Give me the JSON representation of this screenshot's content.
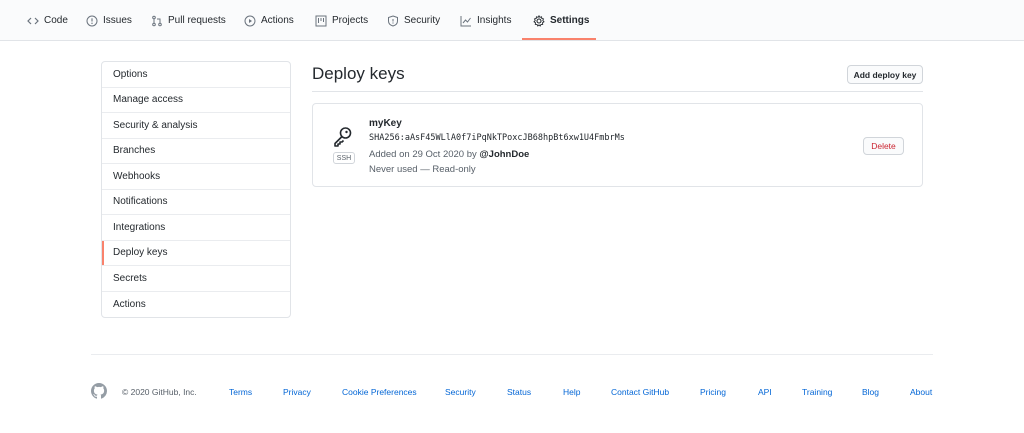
{
  "repo_nav": {
    "tabs": [
      {
        "label": "Code",
        "icon": "code-icon"
      },
      {
        "label": "Issues",
        "icon": "issue-opened-icon"
      },
      {
        "label": "Pull requests",
        "icon": "git-pull-request-icon"
      },
      {
        "label": "Actions",
        "icon": "play-icon"
      },
      {
        "label": "Projects",
        "icon": "project-icon"
      },
      {
        "label": "Security",
        "icon": "shield-icon"
      },
      {
        "label": "Insights",
        "icon": "graph-icon"
      },
      {
        "label": "Settings",
        "icon": "gear-icon",
        "selected": true
      }
    ]
  },
  "sidebar": {
    "items": [
      {
        "label": "Options"
      },
      {
        "label": "Manage access"
      },
      {
        "label": "Security & analysis"
      },
      {
        "label": "Branches"
      },
      {
        "label": "Webhooks"
      },
      {
        "label": "Notifications"
      },
      {
        "label": "Integrations"
      },
      {
        "label": "Deploy keys",
        "selected": true
      },
      {
        "label": "Secrets"
      },
      {
        "label": "Actions"
      }
    ]
  },
  "main": {
    "title": "Deploy keys",
    "add_button": "Add deploy key",
    "keys": [
      {
        "title": "myKey",
        "fingerprint": "SHA256:aAsF45WLlA0f7iPqNkTPoxcJB68hpBt6xw1U4FmbrMs",
        "badge": "SSH",
        "added_prefix": "Added on 29 Oct 2020 by",
        "added_by": "@JohnDoe",
        "usage": "Never used — Read-only",
        "delete_label": "Delete"
      }
    ]
  },
  "footer": {
    "copyright": "© 2020 GitHub, Inc.",
    "links": [
      "Terms",
      "Privacy",
      "Cookie Preferences",
      "Security",
      "Status",
      "Help",
      "Contact GitHub",
      "Pricing",
      "API",
      "Training",
      "Blog",
      "About"
    ]
  },
  "colors": {
    "accent_underline": "#f9826c",
    "link": "#0366d6",
    "danger": "#cb2431",
    "border": "#e1e4e8"
  }
}
